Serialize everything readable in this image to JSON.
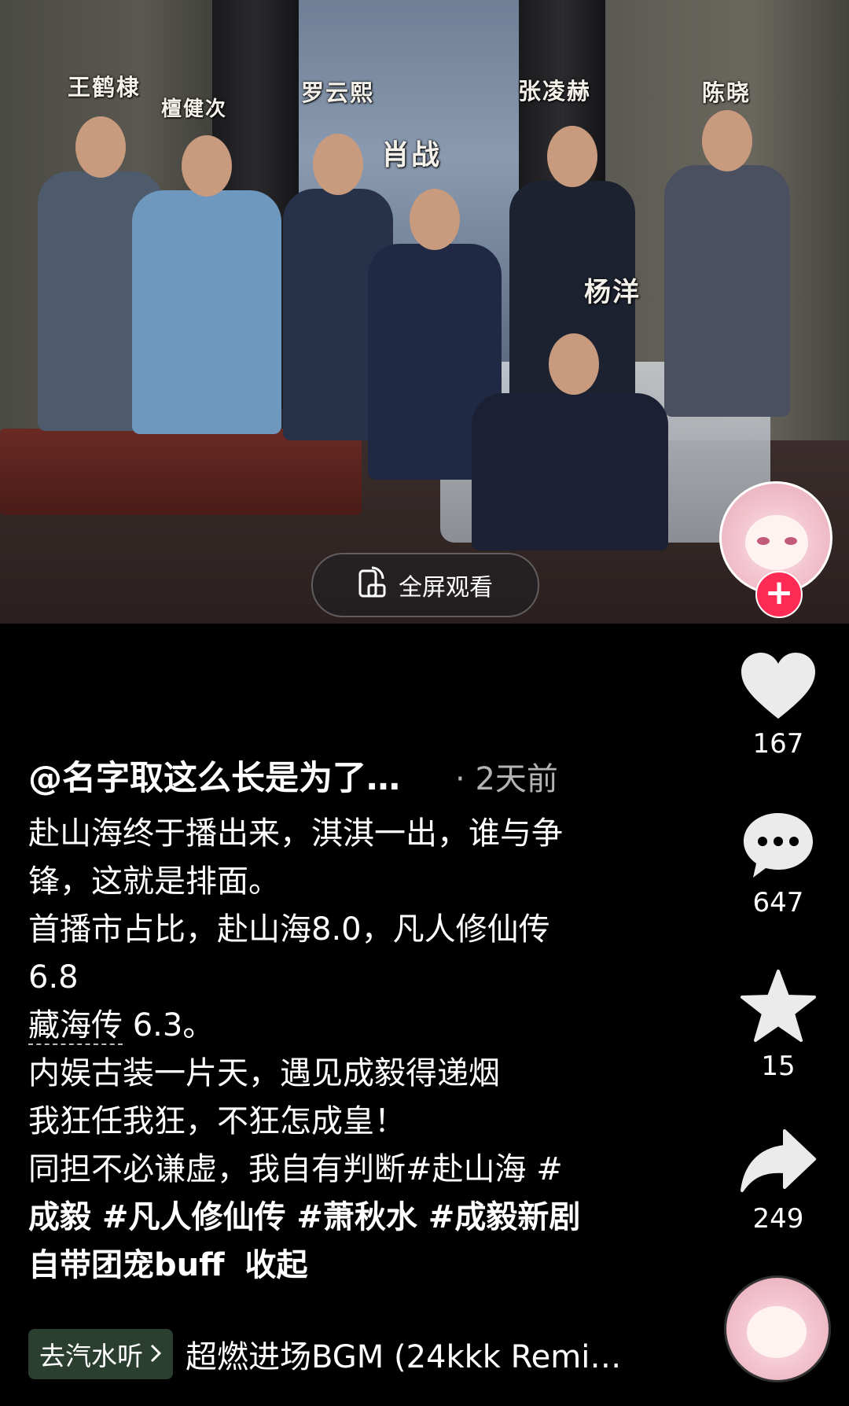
{
  "video": {
    "cast_names": [
      "王鹤棣",
      "檀健次",
      "罗云熙",
      "肖战",
      "张凌赫",
      "陈晓",
      "杨洋"
    ],
    "fullscreen_label": "全屏观看"
  },
  "actions": {
    "like_count": "167",
    "comment_count": "647",
    "favorite_count": "15",
    "share_count": "249"
  },
  "post": {
    "author": "@名字取这么长是为了…",
    "time_separator": "·",
    "time": "2天前",
    "caption_lines": [
      "赴山海终于播出来，淇淇一出，谁与争",
      "锋，这就是排面。",
      "首播市占比，赴山海8.0，凡人修仙传",
      "6.8"
    ],
    "link_text": "藏海传",
    "link_suffix": " 6.3。",
    "caption_lines_2": [
      "内娱古装一片天，遇见成毅得递烟",
      "我狂任我狂，不狂怎成皇！"
    ],
    "hashtag_line_1": "同担不必谦虚，我自有判断#赴山海 #",
    "hashtag_line_2": "成毅 #凡人修仙传 #萧秋水 #成毅新剧",
    "hashtag_line_3": "自带团宠buff",
    "fold_label": "收起"
  },
  "music": {
    "listen_label": "去汽水听",
    "title": "超燃进场BGM (24kkk Remi…"
  }
}
